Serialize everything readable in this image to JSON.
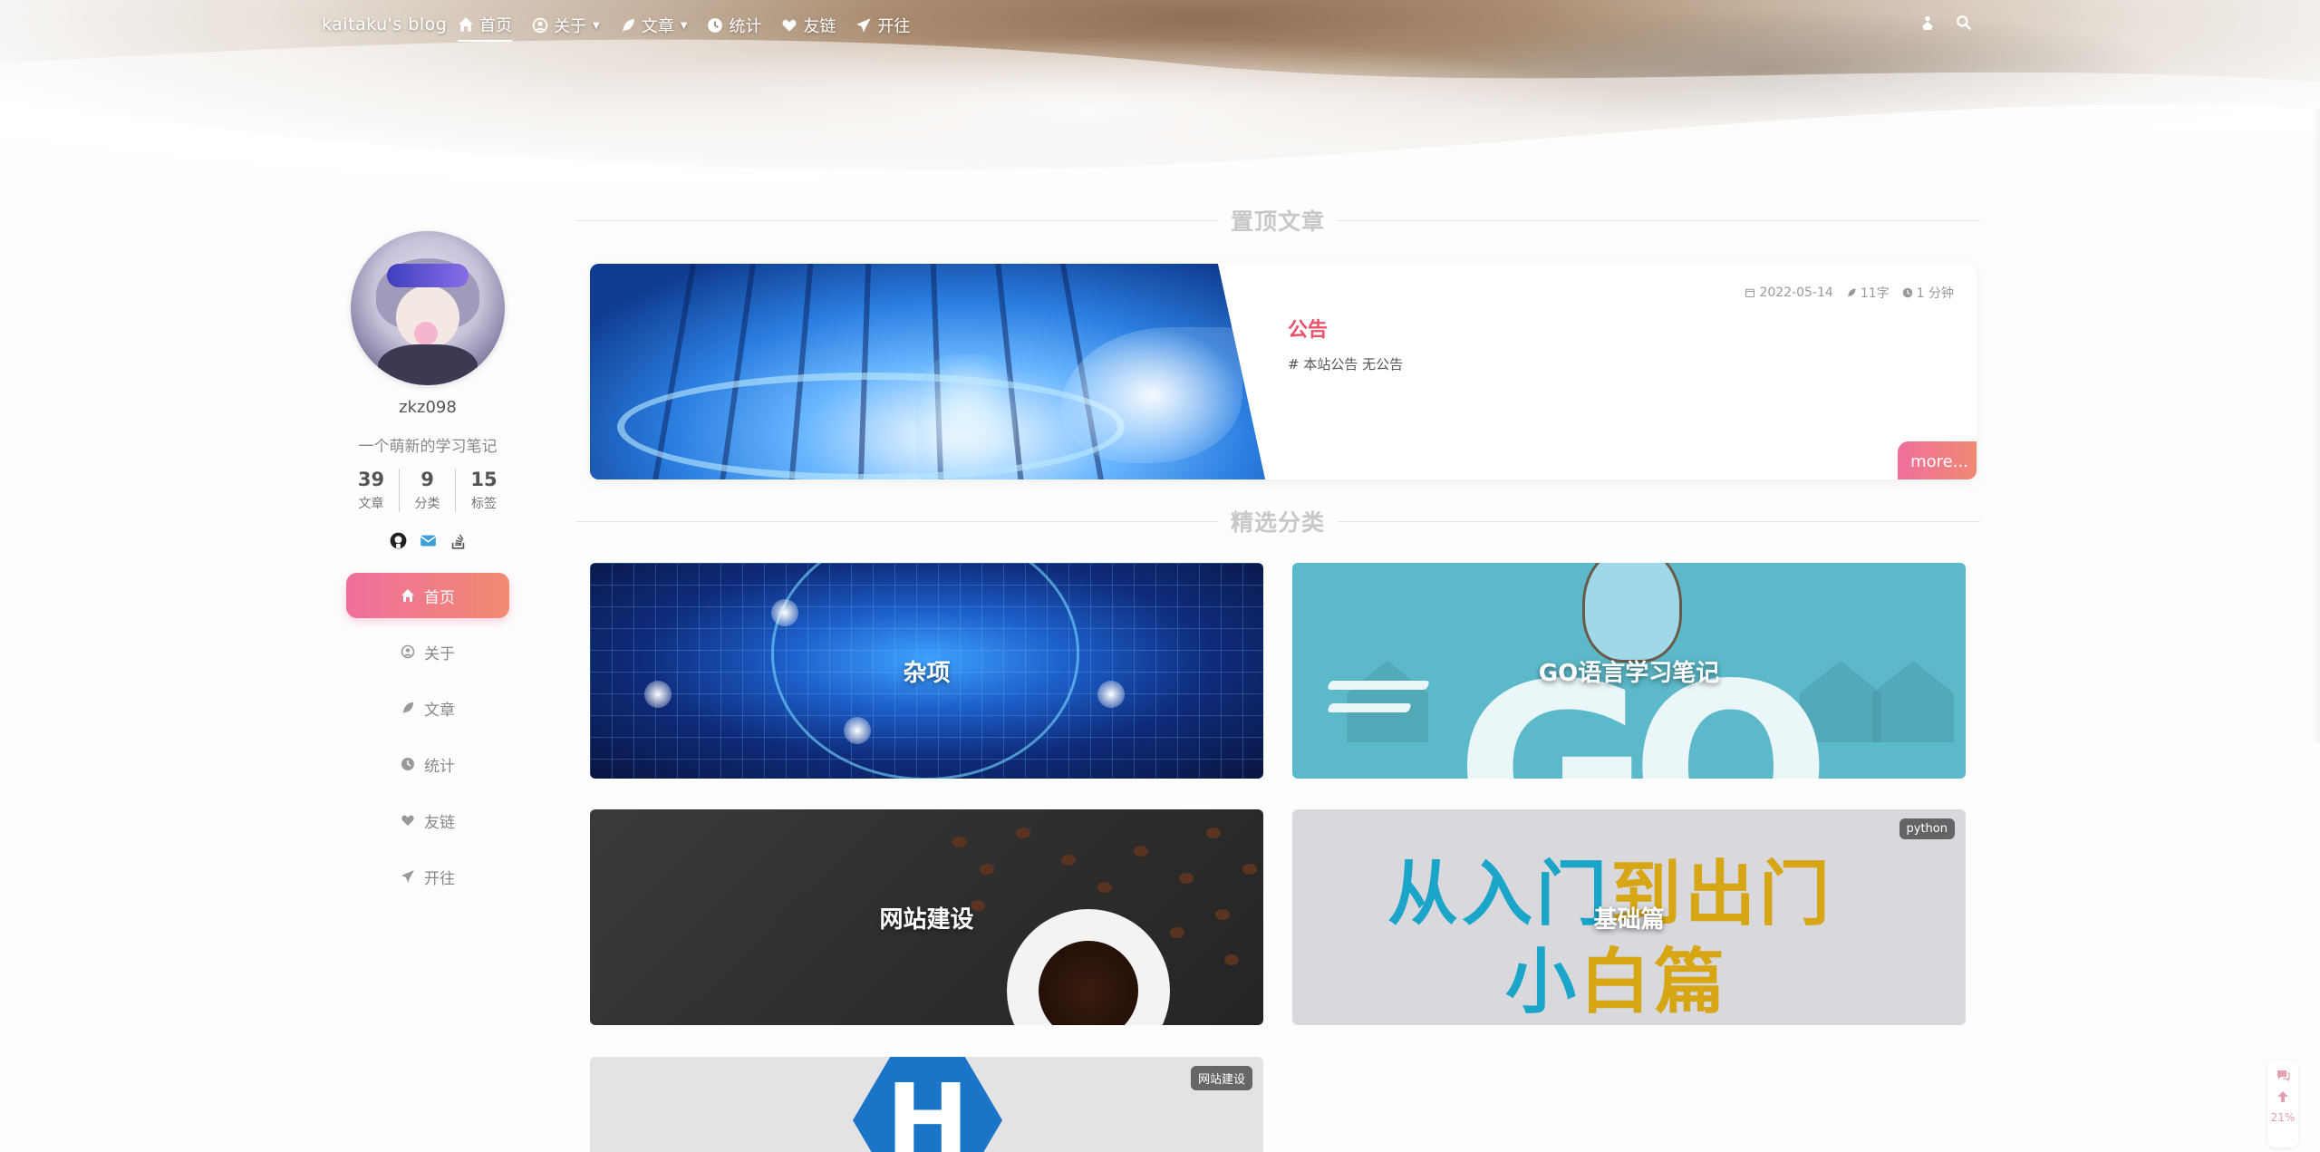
{
  "nav": {
    "brand": "kaitaku's blog",
    "items": [
      {
        "label": "首页",
        "icon": "home-icon",
        "active": true
      },
      {
        "label": "关于",
        "icon": "user-circle-icon",
        "dropdown": true
      },
      {
        "label": "文章",
        "icon": "feather-icon",
        "dropdown": true
      },
      {
        "label": "统计",
        "icon": "clock-icon"
      },
      {
        "label": "友链",
        "icon": "heart-icon"
      },
      {
        "label": "开往",
        "icon": "paper-plane-icon"
      }
    ],
    "right_icons": [
      "person-icon",
      "search-icon"
    ]
  },
  "sidebar": {
    "username": "zkz098",
    "tagline": "一个萌新的学习笔记",
    "stats": [
      {
        "num": "39",
        "label": "文章"
      },
      {
        "num": "9",
        "label": "分类"
      },
      {
        "num": "15",
        "label": "标签"
      }
    ],
    "socials": [
      "github-icon",
      "email-icon",
      "stackoverflow-icon"
    ],
    "menu": [
      {
        "label": "首页",
        "icon": "home-icon",
        "active": true
      },
      {
        "label": "关于",
        "icon": "user-circle-icon"
      },
      {
        "label": "文章",
        "icon": "feather-icon"
      },
      {
        "label": "统计",
        "icon": "clock-icon"
      },
      {
        "label": "友链",
        "icon": "heart-icon"
      },
      {
        "label": "开往",
        "icon": "paper-plane-icon"
      }
    ]
  },
  "sections": {
    "pinned_title": "置顶文章",
    "categories_title": "精选分类"
  },
  "pinned": {
    "date": "2022-05-14",
    "words": "11字",
    "read_time": "1 分钟",
    "title": "公告",
    "excerpt": "# 本站公告 无公告",
    "more": "more..."
  },
  "categories": [
    {
      "label": "杂项"
    },
    {
      "label": "GO语言学习笔记",
      "cover_text": "GO"
    },
    {
      "label": "网站建设"
    },
    {
      "label": "基础篇",
      "tag": "python",
      "cover_lines": [
        "从入门到出门",
        "小白篇"
      ]
    },
    {
      "label": "",
      "tag": "网站建设",
      "cover_text": "H"
    }
  ],
  "float_tools": {
    "progress": "21%"
  },
  "colors": {
    "accent_start": "#ee6f9c",
    "accent_end": "#f28a71",
    "title_red": "#e9546b"
  }
}
